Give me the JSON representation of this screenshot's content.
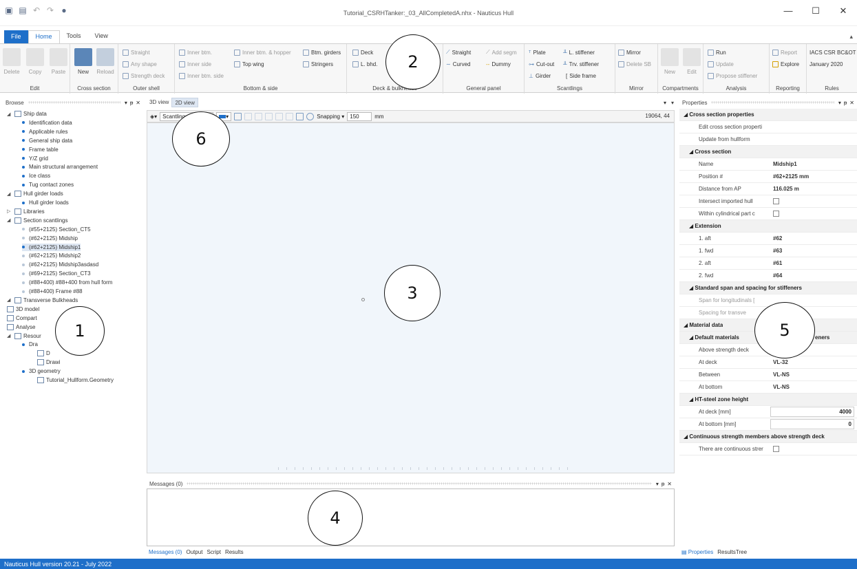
{
  "app": {
    "title": "Tutorial_CSRHTanker:_03_AllCompletedA.nhx - Nauticus Hull",
    "status": "Nauticus Hull version 20.21 - July 2022",
    "window_controls": [
      "—",
      "☐",
      "✕"
    ]
  },
  "ribbon": {
    "tabs": [
      "File",
      "Home",
      "Tools",
      "View"
    ],
    "active_tab": "Home",
    "groups": {
      "edit": {
        "label": "Edit",
        "buttons": [
          "Delete",
          "Copy",
          "Paste"
        ]
      },
      "cross_section": {
        "label": "Cross section",
        "buttons": [
          "New",
          "Reload"
        ]
      },
      "outer_shell": {
        "label": "Outer shell",
        "items": [
          "Straight",
          "Any shape",
          "Strength deck"
        ]
      },
      "bottom_side": {
        "label": "Bottom & side",
        "items": [
          "Inner btm.",
          "Inner side",
          "Inner btm. side",
          "Inner btm. & hopper",
          "Top wing",
          "Btm. girders",
          "Stringers"
        ]
      },
      "deck_bulkheads": {
        "label": "Deck & bulkheads",
        "items": [
          "Deck",
          "L. bhd."
        ]
      },
      "general_panel": {
        "label": "General panel",
        "items": [
          "Straight",
          "Add segm",
          "Curved",
          "Dummy"
        ]
      },
      "scantlings": {
        "label": "Scantlings",
        "items": [
          "Plate",
          "Cut-out",
          "Girder",
          "L. stiffener",
          "Trv. stiffener",
          "Side frame"
        ]
      },
      "mirror": {
        "label": "Mirror",
        "items": [
          "Mirror",
          "Delete SB"
        ]
      },
      "compartments": {
        "label": "Compartments",
        "buttons": [
          "New",
          "Edit"
        ]
      },
      "analysis": {
        "label": "Analysis",
        "items": [
          "Run",
          "Update",
          "Propose stiffener"
        ]
      },
      "reporting": {
        "label": "Reporting",
        "items": [
          "Report",
          "Explore"
        ]
      },
      "rules": {
        "label": "Rules",
        "items": [
          "IACS CSR BC&OT",
          "January 2020"
        ]
      }
    }
  },
  "browse": {
    "title": "Browse",
    "tree": [
      {
        "label": "Ship data",
        "level": 0,
        "type": "folder",
        "expanded": true
      },
      {
        "label": "Identification data",
        "level": 1,
        "type": "item"
      },
      {
        "label": "Applicable rules",
        "level": 1,
        "type": "item"
      },
      {
        "label": "General ship data",
        "level": 1,
        "type": "item"
      },
      {
        "label": "Frame table",
        "level": 1,
        "type": "item"
      },
      {
        "label": "Y/Z grid",
        "level": 1,
        "type": "item"
      },
      {
        "label": "Main structural arrangement",
        "level": 1,
        "type": "item"
      },
      {
        "label": "Ice class",
        "level": 1,
        "type": "item"
      },
      {
        "label": "Tug contact zones",
        "level": 1,
        "type": "item"
      },
      {
        "label": "Hull girder loads",
        "level": 0,
        "type": "folder",
        "expanded": true
      },
      {
        "label": "Hull girder loads",
        "level": 1,
        "type": "item"
      },
      {
        "label": "Libraries",
        "level": 0,
        "type": "folder",
        "expanded": false
      },
      {
        "label": "Section scantlings",
        "level": 0,
        "type": "folder",
        "expanded": true
      },
      {
        "label": "(#55+2125) Section_CT5",
        "level": 1,
        "type": "item-grey"
      },
      {
        "label": "(#62+2125) Midship",
        "level": 1,
        "type": "item-grey"
      },
      {
        "label": "(#62+2125) Midship1",
        "level": 1,
        "type": "item",
        "selected": true
      },
      {
        "label": "(#62+2125) Midship2",
        "level": 1,
        "type": "item-grey"
      },
      {
        "label": "(#62+2125) Midship3asdasd",
        "level": 1,
        "type": "item-grey"
      },
      {
        "label": "(#69+2125) Section_CT3",
        "level": 1,
        "type": "item-grey"
      },
      {
        "label": "(#88+400) #88+400 from hull form",
        "level": 1,
        "type": "item-grey"
      },
      {
        "label": "(#88+400) Frame #88",
        "level": 1,
        "type": "item-grey"
      },
      {
        "label": "Transverse Bulkheads",
        "level": 0,
        "type": "folder",
        "expanded": true
      },
      {
        "label": "3D model",
        "level": 0,
        "type": "leaf"
      },
      {
        "label": "Compart",
        "level": 0,
        "type": "leaf"
      },
      {
        "label": "Analyse",
        "level": 0,
        "type": "leaf"
      },
      {
        "label": "Resour",
        "level": 0,
        "type": "folder",
        "expanded": true
      },
      {
        "label": "Dra",
        "level": 1,
        "type": "item"
      },
      {
        "label": "D",
        "level": 2,
        "type": "doc"
      },
      {
        "label": "Drawi",
        "level": 2,
        "type": "doc"
      },
      {
        "label": "3D geometry",
        "level": 1,
        "type": "item"
      },
      {
        "label": "Tutorial_Hullform.Geometry",
        "level": 2,
        "type": "doc"
      }
    ]
  },
  "view": {
    "tabs": [
      "3D view",
      "2D view"
    ],
    "active_tab": "2D view",
    "layer_combo": "Scantlings",
    "snapping_label": "Snapping",
    "snapping_value": "150",
    "snapping_unit": "mm",
    "coordinates": "19064, 44"
  },
  "messages": {
    "title": "Messages (0)",
    "tabs": [
      "Messages (0)",
      "Output",
      "Script",
      "Results"
    ]
  },
  "properties": {
    "title": "Properties",
    "bottom_tabs": [
      "Properties",
      "ResultsTree"
    ],
    "rows": [
      {
        "kind": "cat",
        "label": "Cross section properties"
      },
      {
        "kind": "row",
        "label": "Edit cross section properti",
        "value": ""
      },
      {
        "kind": "row",
        "label": "Update from hullform",
        "value": ""
      },
      {
        "kind": "sub",
        "label": "Cross section"
      },
      {
        "kind": "row",
        "label": "Name",
        "value": "Midship1"
      },
      {
        "kind": "row",
        "label": "Position #",
        "value": "#62+2125 mm"
      },
      {
        "kind": "row",
        "label": "Distance from AP",
        "value": "116.025 m"
      },
      {
        "kind": "row-check",
        "label": "Intersect imported hull",
        "value": ""
      },
      {
        "kind": "row-check",
        "label": "Within cylindrical part c",
        "value": ""
      },
      {
        "kind": "sub",
        "label": "Extension"
      },
      {
        "kind": "row",
        "label": "1. aft",
        "value": "#62"
      },
      {
        "kind": "row",
        "label": "1. fwd",
        "value": "#63"
      },
      {
        "kind": "row",
        "label": "2. aft",
        "value": "#61"
      },
      {
        "kind": "row",
        "label": "2. fwd",
        "value": "#64"
      },
      {
        "kind": "sub",
        "label": "Standard span and spacing for stiffeners"
      },
      {
        "kind": "row-dim",
        "label": "Span for longitudinals [",
        "value": ""
      },
      {
        "kind": "row-dim",
        "label": "Spacing for transve",
        "value": ""
      },
      {
        "kind": "cat",
        "label": "Material data"
      },
      {
        "kind": "sub",
        "label": "Default materials"
      },
      {
        "kind": "row",
        "label": "Above strength deck",
        "value": ""
      },
      {
        "kind": "row",
        "label": "At deck",
        "value": "VL-32"
      },
      {
        "kind": "row",
        "label": "Between",
        "value": "VL-NS"
      },
      {
        "kind": "row",
        "label": "At bottom",
        "value": "VL-NS"
      },
      {
        "kind": "sub",
        "label": "HT-steel zone height"
      },
      {
        "kind": "row-input",
        "label": "At deck [mm]",
        "value": "4000"
      },
      {
        "kind": "row-input",
        "label": "At bottom [mm]",
        "value": "0"
      },
      {
        "kind": "cat",
        "label": "Continuous strength members above strength deck"
      },
      {
        "kind": "row-check",
        "label": "There are continuous strer",
        "value": ""
      }
    ],
    "partial_label": "eners"
  },
  "callouts": [
    "1",
    "2",
    "3",
    "4",
    "5",
    "6"
  ]
}
